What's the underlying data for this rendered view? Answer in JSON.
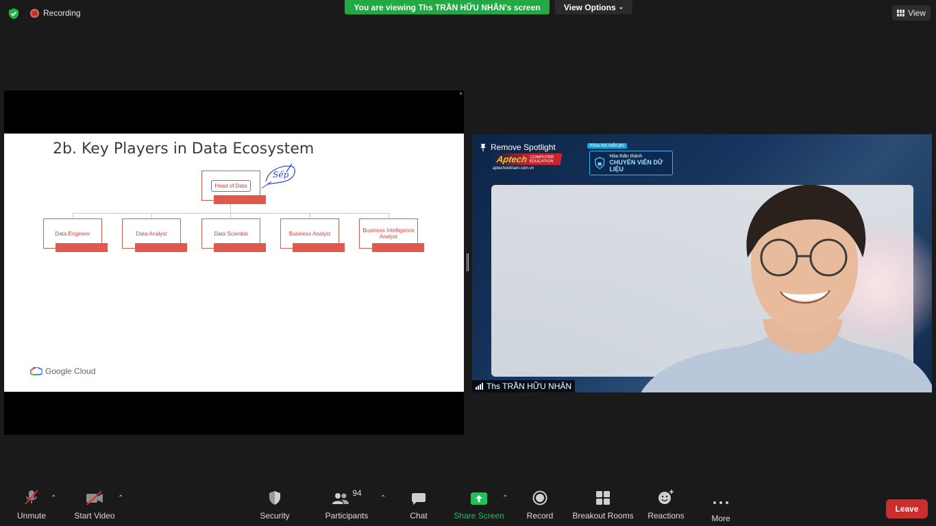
{
  "status": {
    "recording_label": "Recording",
    "viewing_banner": "You are viewing Ths TRẦN HỮU NHÂN's screen",
    "view_options_label": "View Options",
    "view_label": "View"
  },
  "slide": {
    "title": "2b. Key Players in Data Ecosystem",
    "head_node": "Head of Data",
    "handwriting": "Sếp",
    "nodes": [
      "Data Engineer",
      "Data Analyst",
      "Data Scientist",
      "Business Analyst",
      "Business Intelligence Analyst"
    ],
    "footer_logo": "Google Cloud"
  },
  "video": {
    "remove_spotlight_label": "Remove Spotlight",
    "participant_name": "Ths TRẦN HỮU NHÂN",
    "aptech_logo": "Aptech",
    "aptech_sub": "COMPUTER EDUCATION",
    "aptech_url": "aptechvietnam.com.vn",
    "chip_text": "Khóa học miễn phí",
    "badge_line1": "Hóa thân thành",
    "badge_line2": "CHUYÊN VIÊN DỮ LIỆU"
  },
  "toolbar": {
    "unmute": "Unmute",
    "start_video": "Start Video",
    "security": "Security",
    "participants": "Participants",
    "participant_count": "94",
    "chat": "Chat",
    "share_screen": "Share Screen",
    "record": "Record",
    "breakout_rooms": "Breakout Rooms",
    "reactions": "Reactions",
    "more": "More",
    "leave": "Leave"
  },
  "colors": {
    "banner_green": "#23a943",
    "share_green": "#22c05a",
    "leave_red": "#cc2e2e",
    "node_red": "#dd5a4d"
  }
}
